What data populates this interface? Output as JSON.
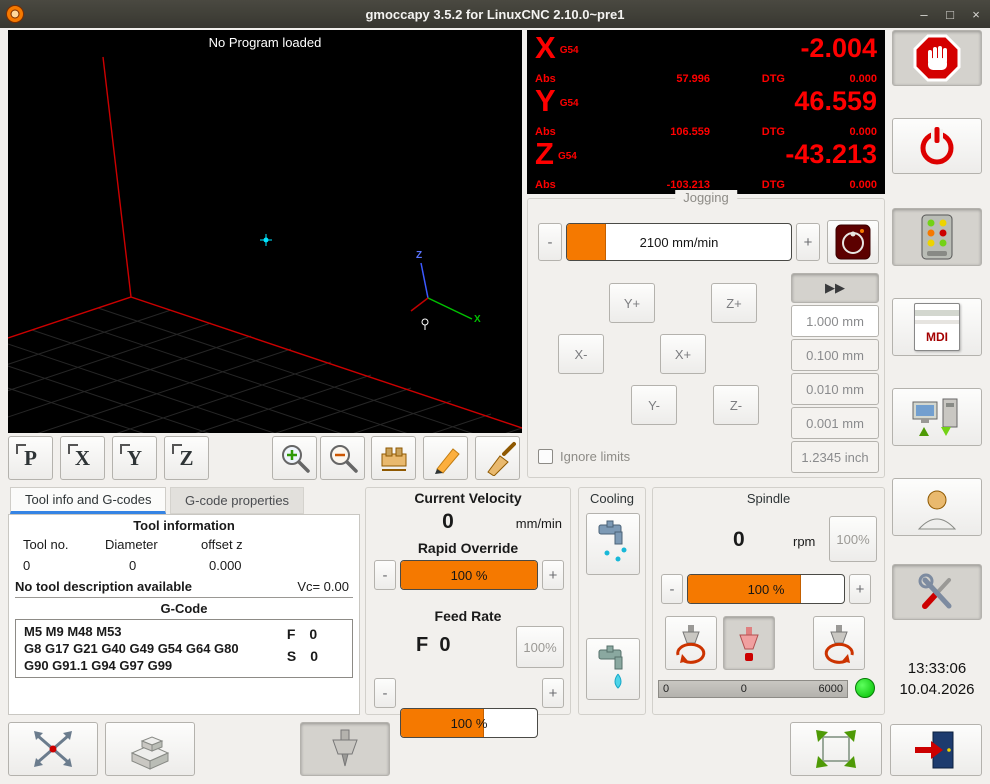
{
  "window": {
    "title": "gmoccapy 3.5.2 for LinuxCNC 2.10.0~pre1",
    "minimize": "–",
    "maximize": "□",
    "close": "×"
  },
  "ui": {
    "minus": "-",
    "plus": "+"
  },
  "preview": {
    "message": "No Program loaded",
    "triad": {
      "x": "X",
      "z": "Z"
    },
    "toolbar": [
      "P",
      "X",
      "Y",
      "Z"
    ]
  },
  "dro": {
    "axes": [
      {
        "letter": "X",
        "system": "G54",
        "value": "-2.004",
        "abs_label": "Abs",
        "abs_value": "57.996",
        "dtg_label": "DTG",
        "dtg_value": "0.000"
      },
      {
        "letter": "Y",
        "system": "G54",
        "value": "46.559",
        "abs_label": "Abs",
        "abs_value": "106.559",
        "dtg_label": "DTG",
        "dtg_value": "0.000"
      },
      {
        "letter": "Z",
        "system": "G54",
        "value": "-43.213",
        "abs_label": "Abs",
        "abs_value": "-103.213",
        "dtg_label": "DTG",
        "dtg_value": "0.000"
      }
    ]
  },
  "jogging": {
    "title": "Jogging",
    "speed": "2100 mm/min",
    "fast": "▶▶",
    "buttons": [
      "Y+",
      "Z+",
      "X-",
      "X+",
      "Y-",
      "Z-"
    ],
    "increments": [
      "1.000 mm",
      "0.100 mm",
      "0.010 mm",
      "0.001 mm",
      "1.2345 inch"
    ],
    "ignore_limits": "Ignore limits"
  },
  "sidebar": {
    "mdi": "MDI",
    "time": "13:33:06",
    "date": "10.04.2026"
  },
  "notebook": {
    "tabs": [
      "Tool info and G-codes",
      "G-code properties"
    ],
    "tool_header": "Tool information",
    "columns": [
      "Tool no.",
      "Diameter",
      "offset z"
    ],
    "values": [
      "0",
      "0",
      "0.000"
    ],
    "description": "No tool description available",
    "vc": "Vc= 0.00",
    "gcode_header": "G-Code",
    "gcode_lines": [
      "M5 M9 M48 M53",
      "G8 G17 G21 G40 G49 G54 G64 G80",
      "G90 G91.1 G94 G97 G99"
    ],
    "f_label": "F",
    "f_value": "0",
    "s_label": "S",
    "s_value": "0"
  },
  "velocity": {
    "title": "Current Velocity",
    "value": "0",
    "unit": "mm/min",
    "rapid_title": "Rapid Override",
    "rapid_value": "100 %",
    "feed_title": "Feed Rate",
    "feed_letter": "F",
    "feed_number": "0",
    "feed_pct": "100%",
    "feed_value": "100 %"
  },
  "cooling": {
    "title": "Cooling"
  },
  "spindle": {
    "title": "Spindle",
    "value": "0",
    "unit": "rpm",
    "pct": "100%",
    "slider_value": "100 %",
    "bar_left": "0",
    "bar_mid": "0",
    "bar_right": "6000"
  }
}
